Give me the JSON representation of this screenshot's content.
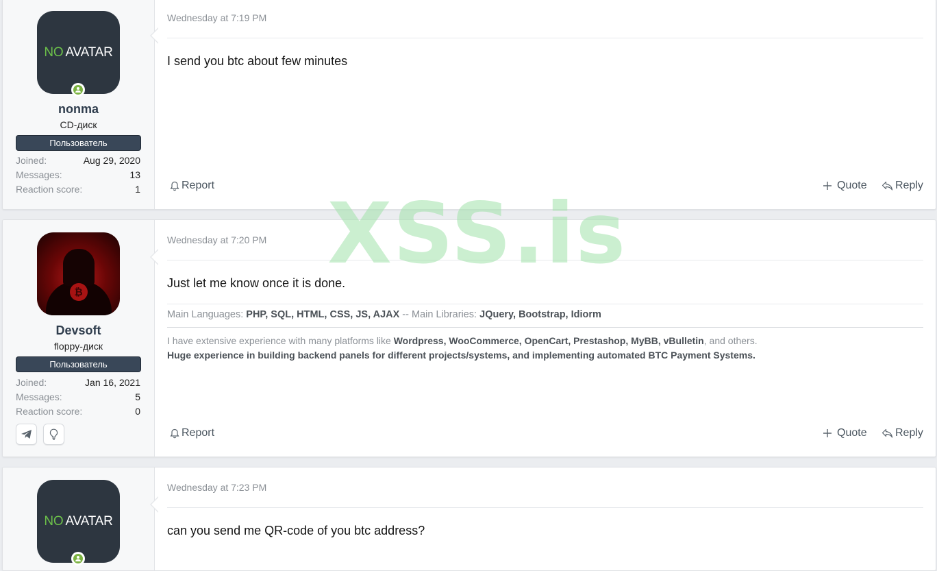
{
  "posts": [
    {
      "avatar": {
        "type": "no-avatar",
        "text_no": "NO",
        "text_avatar": "AVATAR"
      },
      "online": true,
      "username": "nonma",
      "user_title": "CD-диск",
      "banner": "Пользователь",
      "stats": [
        {
          "label": "Joined:",
          "value": "Aug 29, 2020"
        },
        {
          "label": "Messages:",
          "value": "13"
        },
        {
          "label": "Reaction score:",
          "value": "1"
        }
      ],
      "date": "Wednesday at 7:19 PM",
      "message": "I send you btc about few minutes",
      "actions": {
        "report": "Report",
        "quote": "Quote",
        "reply": "Reply"
      }
    },
    {
      "avatar": {
        "type": "image",
        "icon": "hooded-figure-bitcoin-avatar"
      },
      "online": false,
      "username": "Devsoft",
      "user_title": "floppy-диск",
      "banner": "Пользователь",
      "stats": [
        {
          "label": "Joined:",
          "value": "Jan 16, 2021"
        },
        {
          "label": "Messages:",
          "value": "5"
        },
        {
          "label": "Reaction score:",
          "value": "0"
        }
      ],
      "contacts": [
        "telegram-icon",
        "lightbulb-icon"
      ],
      "date": "Wednesday at 7:20 PM",
      "message": "Just let me know once it is done.",
      "signature": {
        "line1_prefix": "Main Languages: ",
        "line1_langs": "PHP, SQL, HTML, CSS, JS, AJAX",
        "line1_mid": " -- Main Libraries: ",
        "line1_libs": "JQuery, Bootstrap, Idiorm",
        "line2_prefix": "I have extensive experience with many platforms like ",
        "line2_platforms": "Wordpress, WooCommerce, OpenCart, Prestashop, MyBB, vBulletin",
        "line2_suffix": ", and others.",
        "line3": "Huge experience in building backend panels for different projects/systems, and implementing automated BTC Payment Systems."
      },
      "actions": {
        "report": "Report",
        "quote": "Quote",
        "reply": "Reply"
      }
    },
    {
      "avatar": {
        "type": "no-avatar",
        "text_no": "NO",
        "text_avatar": "AVATAR"
      },
      "online": true,
      "date": "Wednesday at 7:23 PM",
      "message": "can you send me QR-code of you btc address?"
    }
  ],
  "watermark": "XSS.is",
  "colors": {
    "page_bg": "#ebedf0",
    "user_cell_bg": "#f7f8f9",
    "banner_bg": "#394758",
    "username": "#2f3d4d",
    "online": "#7cb342",
    "no_green": "#6cc04a",
    "avatar_bg": "#2d3640"
  }
}
